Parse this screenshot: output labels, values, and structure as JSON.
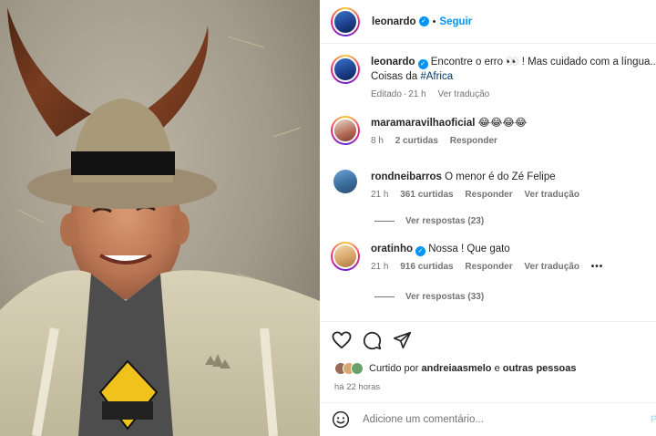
{
  "header": {
    "username": "leonardo",
    "separator": "•",
    "follow_label": "Seguir"
  },
  "caption": {
    "username": "leonardo",
    "text": "Encontre o erro 👀 ! Mas cuidado com a língua...",
    "text_line2": "Coisas da ",
    "hashtag": "#Africa",
    "edited": "Editado",
    "separator": "·",
    "time": "21 h",
    "see_translation": "Ver tradução"
  },
  "comments": [
    {
      "username": "maramaravilhaoficial",
      "text": "😂😂😂😂",
      "time": "8 h",
      "likes": "2 curtidas",
      "reply": "Responder",
      "verified": false
    },
    {
      "username": "rondneibarros",
      "text": "O menor é do Zé Felipe",
      "time": "21 h",
      "likes": "361 curtidas",
      "reply": "Responder",
      "translation": "Ver tradução",
      "view_replies": "Ver respostas (23)",
      "verified": false
    },
    {
      "username": "oratinho",
      "text": "Nossa ! Que gato",
      "time": "21 h",
      "likes": "916 curtidas",
      "reply": "Responder",
      "translation": "Ver tradução",
      "more": "•••",
      "view_replies": "Ver respostas (33)",
      "verified": true
    }
  ],
  "actions": {
    "icons": [
      "heart-icon",
      "comment-icon",
      "share-icon"
    ]
  },
  "likes": {
    "prefix": "Curtido por",
    "user": "andreiaasmelo",
    "connector": "e",
    "others": "outras pessoas"
  },
  "post_time": "há 22 horas",
  "add_comment": {
    "placeholder": "Adicione um comentário...",
    "publish": "Pu"
  },
  "colors": {
    "link_blue": "#0095f6",
    "hashtag": "#00376b",
    "secondary_text": "#737373",
    "divider": "#efefef"
  }
}
